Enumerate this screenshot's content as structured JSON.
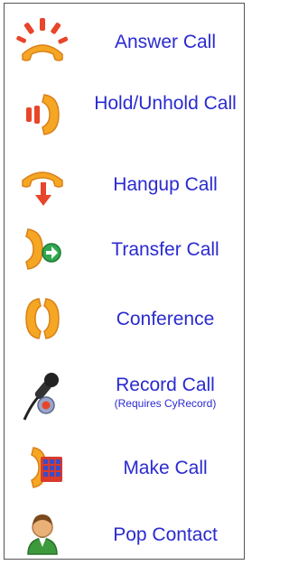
{
  "actions": [
    {
      "label": "Answer Call",
      "icon": "answer-call-icon"
    },
    {
      "label": "Hold/Unhold Call",
      "icon": "hold-call-icon"
    },
    {
      "label": "Hangup Call",
      "icon": "hangup-call-icon"
    },
    {
      "label": "Transfer Call",
      "icon": "transfer-call-icon"
    },
    {
      "label": "Conference",
      "icon": "conference-icon"
    },
    {
      "label": "Record Call",
      "sublabel": "(Requires CyRecord)",
      "icon": "record-call-icon"
    },
    {
      "label": "Make Call",
      "icon": "make-call-icon"
    },
    {
      "label": "Pop Contact",
      "icon": "pop-contact-icon"
    }
  ],
  "colors": {
    "label": "#2a2ad0",
    "handset": "#f5a623",
    "handset_dark": "#d9811a",
    "alert_red": "#e8452a",
    "arrow_green": "#2fa84f",
    "keypad_red": "#d93a2b",
    "keypad_blue": "#3a4cc9",
    "contact_green": "#3c9a3c",
    "contact_skin": "#e9b078"
  }
}
